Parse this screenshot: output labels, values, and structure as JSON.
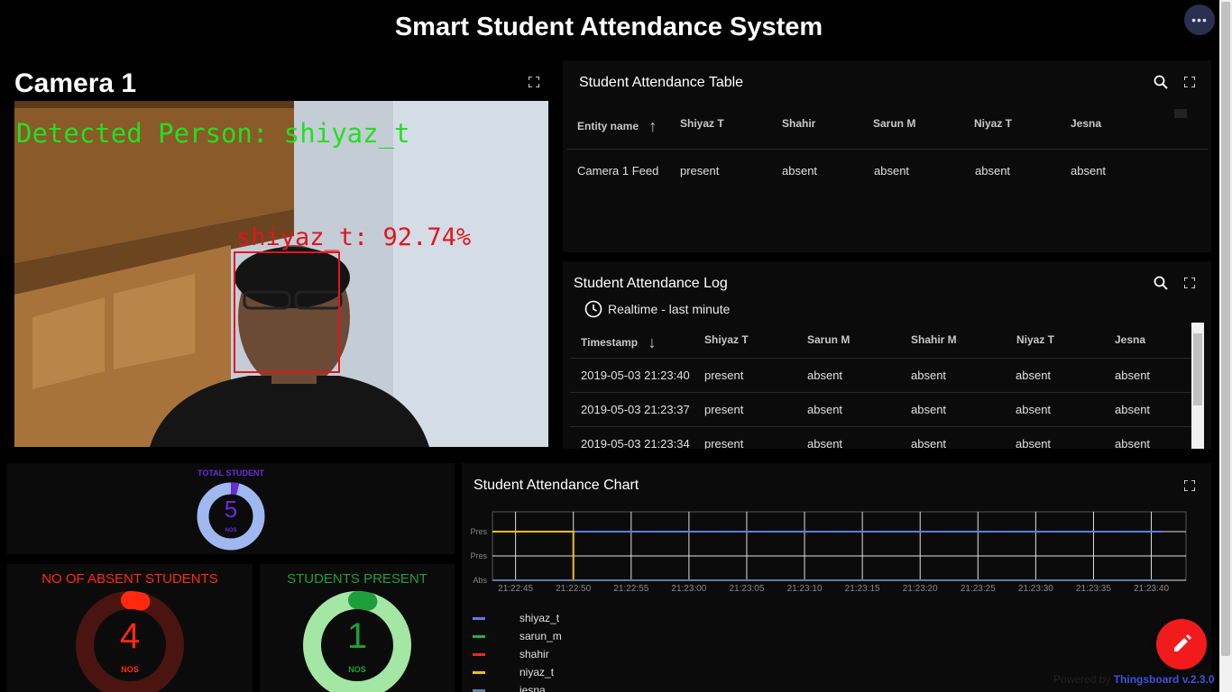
{
  "page": {
    "title": "Smart Student Attendance System"
  },
  "camera": {
    "title": "Camera 1",
    "detected_text": "Detected Person: shiyaz_t",
    "box_label": "shiyaz_t: 92.74%"
  },
  "attendance_table": {
    "title": "Student Attendance Table",
    "columns": [
      "Entity name",
      "Shiyaz T",
      "Shahir",
      "Sarun M",
      "Niyaz T",
      "Jesna"
    ],
    "rows": [
      [
        "Camera 1 Feed",
        "present",
        "absent",
        "absent",
        "absent",
        "absent"
      ]
    ]
  },
  "attendance_log": {
    "title": "Student Attendance Log",
    "timewindow": "Realtime - last minute",
    "columns": [
      "Timestamp",
      "Shiyaz T",
      "Sarun M",
      "Shahir M",
      "Niyaz T",
      "Jesna"
    ],
    "rows": [
      [
        "2019-05-03 21:23:40",
        "present",
        "absent",
        "absent",
        "absent",
        "absent"
      ],
      [
        "2019-05-03 21:23:37",
        "present",
        "absent",
        "absent",
        "absent",
        "absent"
      ],
      [
        "2019-05-03 21:23:34",
        "present",
        "absent",
        "absent",
        "absent",
        "absent"
      ]
    ]
  },
  "total_student": {
    "label": "TOTAL STUDENT",
    "value": "5",
    "unit": "NOS",
    "fraction": 0.04,
    "color": "#6a2bd9",
    "track": "#9fb8f0"
  },
  "absent": {
    "label": "NO OF ABSENT STUDENTS",
    "value": "4",
    "unit": "NOS",
    "fraction": 0.04,
    "color": "#ff2a0d",
    "track": "#4a1510"
  },
  "present": {
    "label": "STUDENTS PRESENT",
    "value": "1",
    "unit": "NOS",
    "fraction": 0.04,
    "color": "#1e9e3a",
    "track": "#a4e6a4"
  },
  "chart_data": {
    "type": "line",
    "title": "Student Attendance Chart",
    "y_categories": [
      "Abs",
      "Pres",
      "Pres"
    ],
    "x_ticks": [
      "21:22:45",
      "21:22:50",
      "21:22:55",
      "21:23:00",
      "21:23:05",
      "21:23:10",
      "21:23:15",
      "21:23:20",
      "21:23:25",
      "21:23:30",
      "21:23:35",
      "21:23:40"
    ],
    "series": [
      {
        "name": "shiyaz_t",
        "color": "#5b7be8",
        "points": [
          [
            "21:22:50",
            1
          ],
          [
            "21:23:41",
            1
          ]
        ]
      },
      {
        "name": "sarun_m",
        "color": "#1fb040",
        "points": [
          [
            "21:22:43",
            0
          ],
          [
            "21:23:41",
            0
          ]
        ]
      },
      {
        "name": "shahir",
        "color": "#e03020",
        "points": [
          [
            "21:22:43",
            0
          ],
          [
            "21:23:41",
            0
          ]
        ]
      },
      {
        "name": "niyaz_t",
        "color": "#f0c010",
        "points": [
          [
            "21:22:43",
            1
          ],
          [
            "21:22:50",
            1
          ],
          [
            "21:22:50",
            0
          ]
        ]
      },
      {
        "name": "jesna",
        "color": "#607d9b",
        "points": [
          [
            "21:22:43",
            0
          ],
          [
            "21:23:41",
            0
          ]
        ]
      }
    ]
  },
  "footer": {
    "powered_by": "Powered by",
    "brand": "Thingsboard v.2.3.0"
  }
}
